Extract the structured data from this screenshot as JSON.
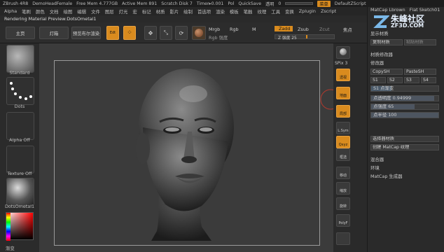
{
  "titlebar": {
    "app": "ZBrush 4R8",
    "doc": "DemoHeadFemale",
    "free_mem": "Free Mem 4.777GB",
    "active_mem": "Active Mem 891",
    "scratch": "Scratch Disk 7",
    "timer": "Timer▸0.001",
    "poly": "Pol",
    "quicksave": "QuickSave",
    "transparency_label": "透明",
    "transparency_value": "0",
    "menu_btn": "菜单",
    "script": "DefaultZScript"
  },
  "menubar": {
    "items": [
      "Alpha",
      "笔刷",
      "颜色",
      "文档",
      "绘图",
      "编辑",
      "文件",
      "图层",
      "灯光",
      "宏",
      "标记",
      "材质",
      "影片",
      "绘制",
      "首选项",
      "渲染",
      "模板",
      "笔触",
      "纹理",
      "工具",
      "变换",
      "Zplugin",
      "Zscript"
    ]
  },
  "status": {
    "text": "Rendering Material Preview:DotsOmetal1"
  },
  "shelf": {
    "home": "主页",
    "lightbox": "灯箱",
    "lightbox_arrow": "▸",
    "preview_render": "预览布尔渲染",
    "edit": "Edt",
    "draw": "绘画",
    "move": "移动",
    "scale": "缩放",
    "rotate": "旋转",
    "mrgb": "Mrgb",
    "rgb": "Rgb",
    "m": "M",
    "rgb_intensity": "Rgb 强度",
    "zadd": "Zadd",
    "zsub": "Zsub",
    "zcut": "Zcut",
    "z_intensity_label": "Z 强度",
    "z_intensity_value": "25",
    "focal_shift": "焦点"
  },
  "leftpanel": {
    "standard": "Standard",
    "dots": "Dots",
    "alpha_off": "Alpha Off",
    "texture_off": "Texture Off",
    "material": "DotsOmetal1",
    "gradient": "渐变"
  },
  "toolcol": {
    "spix_label": "SPix",
    "spix_value": "3",
    "persp": "透视",
    "floor": "地面",
    "local": "局部",
    "lsym": "L.Sym",
    "xyz": "Qxyz",
    "frame": "框选",
    "move": "移动",
    "scale": "缩放",
    "rotate": "旋转",
    "polyf": "PolyF"
  },
  "rightpanel": {
    "matcap_title": "MatCap Lbrown",
    "flat": "Flat Sketch01",
    "show_material": "显示材质",
    "copy_material": "复制材质",
    "paste_material": "粘贴材质",
    "matcap_editor": "材质修改器",
    "modifier": "修改器",
    "copysh": "CopySH",
    "pastesh": "PasteSH",
    "s_tabs": [
      "S1",
      "S2",
      "S3",
      "S4"
    ],
    "s1_gradient_label": "S1 点渐变",
    "opacity_label": "点透明度",
    "opacity_value": "0.94999",
    "intensity_label": "点强度",
    "intensity_value": "65",
    "radius_label": "点半径",
    "radius_value": "100",
    "select_material": "选择器材质",
    "create_matcap": "创建 MatCap 纹理",
    "mixer": "混合器",
    "environment": "环境",
    "matcap_gen": "MatCap 生成器",
    "logo_title": "朱峰社区",
    "logo_url": "ZF3D.COM"
  },
  "colors": {
    "accent": "#d98b1e",
    "viewport_bg": "#3b3b3b",
    "panel_bg": "#2a2a2a"
  }
}
